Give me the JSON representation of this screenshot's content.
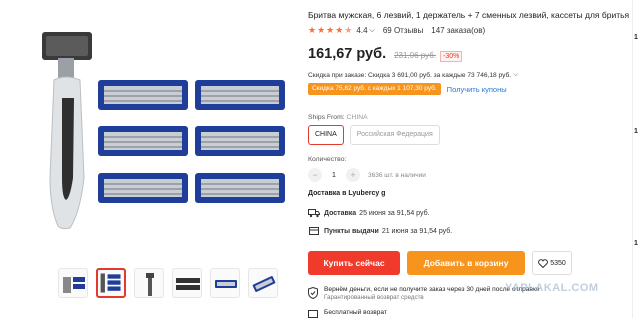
{
  "product": {
    "title": "Бритва мужская, 6 лезвий, 1 держатель + 7 сменных лезвий, кассеты для бритья",
    "rating": "4.4",
    "reviews": "69 Отзывы",
    "orders": "147 заказа(ов)",
    "price": "161,67 руб.",
    "old_price": "231,06 руб.",
    "discount": "-30%",
    "discount_line": "Скидка при заказе: Скидка 3 691,00 руб. за каждые 73 746,18 руб.",
    "coupon": "Скидка 75,82 руб. с каждых 1 107,30 руб.",
    "get_coupons": "Получить купоны"
  },
  "shipping": {
    "ships_from_label": "Ships From:",
    "ships_from_value": "CHINA",
    "options": [
      "CHINA",
      "Российская Федерация"
    ],
    "quantity_label": "Количество:",
    "quantity": "1",
    "stock": "3636 шт. в наличии",
    "delivery_to": "Доставка в Lyubercy g",
    "delivery_label": "Доставка",
    "delivery_text": "25 июня за 91,54 руб.",
    "pickup_label": "Пункты выдачи",
    "pickup_text": "21 июня за 91,54 руб."
  },
  "actions": {
    "buy": "Купить сейчас",
    "cart": "Добавить в корзину",
    "wishlist_count": "5350"
  },
  "guarantee": {
    "title": "Вернём деньги, если не получите заказ через 30 дней после отправки",
    "subtitle": "Гарантированный возврат средств",
    "free_return": "Бесплатный возврат"
  },
  "watermark": "YAPLAKAL.COM",
  "edge": [
    "1",
    "1",
    "1"
  ],
  "colors": {
    "accent_red": "#ef3a2c",
    "accent_orange": "#f7941d",
    "link_blue": "#2a7ad6",
    "star": "#ff6d2f"
  },
  "icons": {
    "ship": "truck-icon",
    "pickup": "pickup-point-icon",
    "wishlist": "heart-icon",
    "guarantee": "shield-icon",
    "return": "return-box-icon"
  }
}
